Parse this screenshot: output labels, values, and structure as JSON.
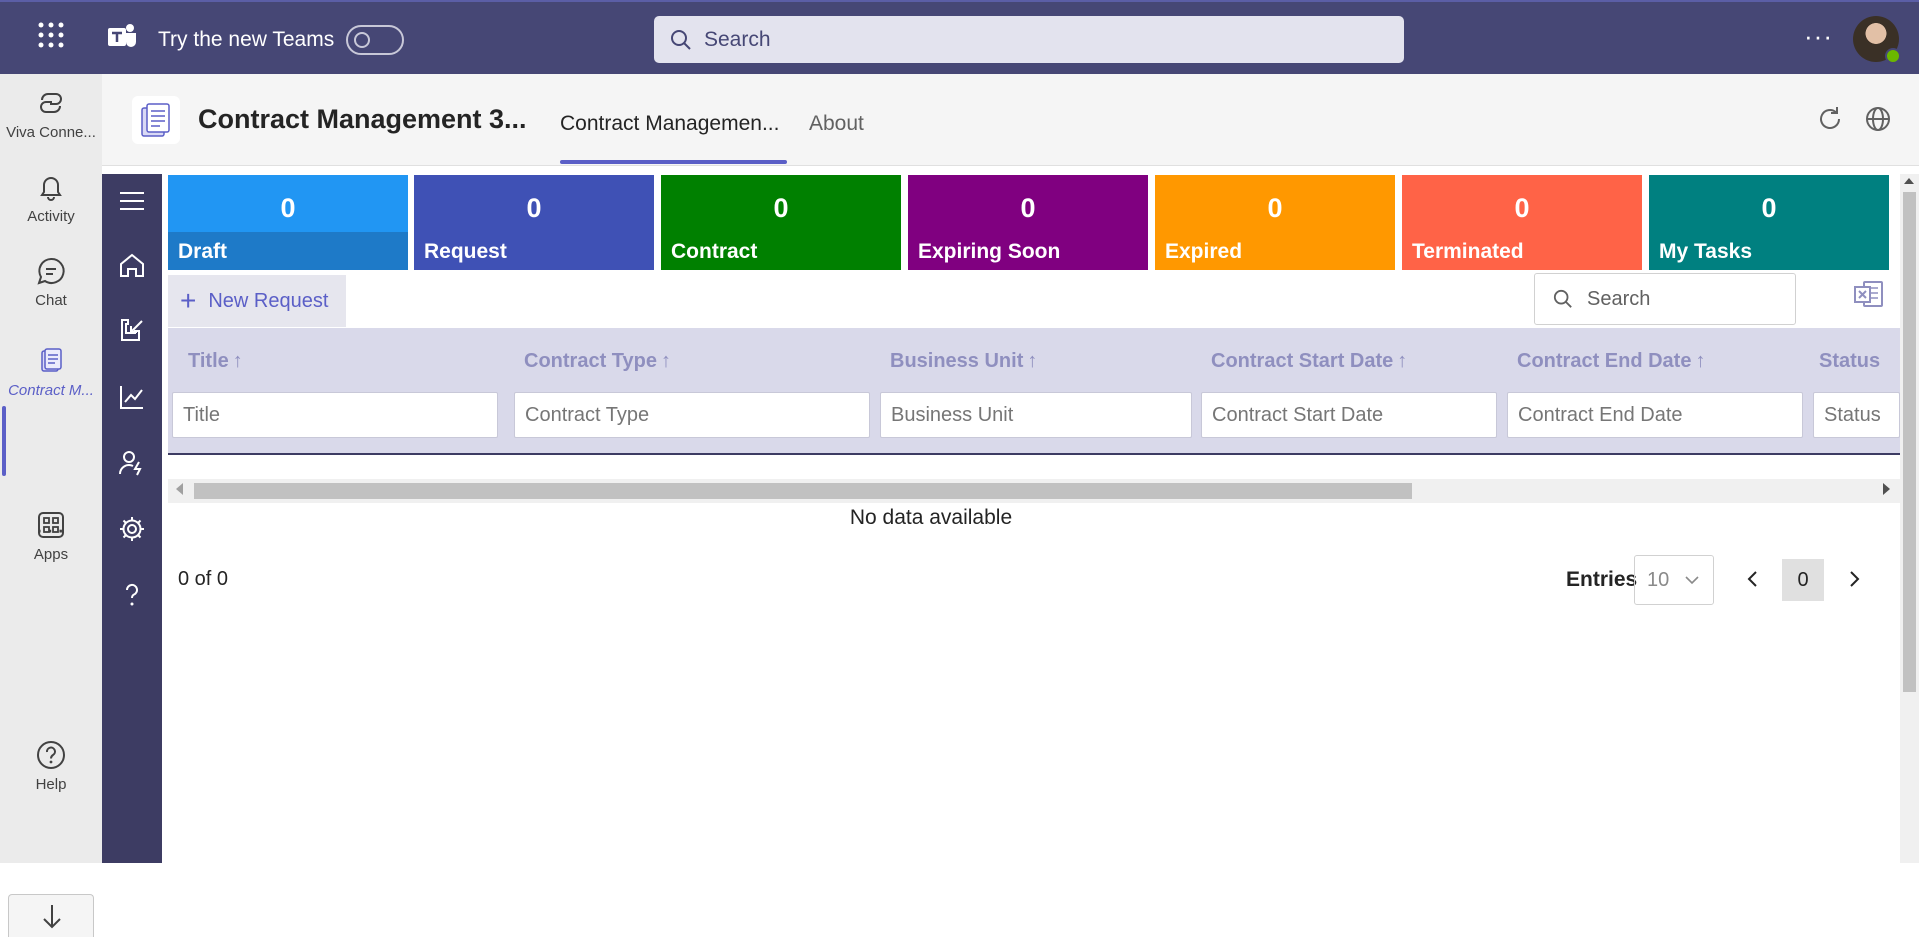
{
  "topbar": {
    "try_label": "Try the new Teams",
    "search_placeholder": "Search",
    "more_label": "···"
  },
  "rail": {
    "items": [
      {
        "label": "Viva Conne...",
        "icon": "viva-connections-icon"
      },
      {
        "label": "Activity",
        "icon": "bell-icon"
      },
      {
        "label": "Chat",
        "icon": "chat-icon"
      },
      {
        "label": "Contract M...",
        "icon": "contract-app-icon"
      },
      {
        "label": "Apps",
        "icon": "apps-icon"
      },
      {
        "label": "Help",
        "icon": "help-icon"
      }
    ],
    "more_label": "···"
  },
  "app": {
    "title": "Contract Management 3...",
    "tabs": [
      {
        "label": "Contract Managemen..."
      },
      {
        "label": "About"
      }
    ]
  },
  "tiles": [
    {
      "label": "Draft",
      "count": "0",
      "color": "#2196f3",
      "strip": "#1e7ac8"
    },
    {
      "label": "Request",
      "count": "0",
      "color": "#3f51b5",
      "strip": "#3f51b5"
    },
    {
      "label": "Contract",
      "count": "0",
      "color": "#008000",
      "strip": "#008000"
    },
    {
      "label": "Expiring Soon",
      "count": "0",
      "color": "#800080",
      "strip": "#800080"
    },
    {
      "label": "Expired",
      "count": "0",
      "color": "#ff9800",
      "strip": "#ff9800"
    },
    {
      "label": "Terminated",
      "count": "0",
      "color": "#ff6347",
      "strip": "#ff6347"
    },
    {
      "label": "My Tasks",
      "count": "0",
      "color": "#008080",
      "strip": "#008080"
    }
  ],
  "toolbar": {
    "new_request_label": "New Request",
    "search_placeholder": "Search"
  },
  "grid": {
    "columns": [
      {
        "header": "Title",
        "filter_placeholder": "Title"
      },
      {
        "header": "Contract Type",
        "filter_placeholder": "Contract Type"
      },
      {
        "header": "Business Unit",
        "filter_placeholder": "Business Unit"
      },
      {
        "header": "Contract Start Date",
        "filter_placeholder": "Contract Start Date"
      },
      {
        "header": "Contract End Date",
        "filter_placeholder": "Contract End Date"
      },
      {
        "header": "Status",
        "filter_placeholder": "Status"
      }
    ],
    "sort_arrow": "↑",
    "empty_text": "No data available"
  },
  "pagination": {
    "count_text": "0 of 0",
    "entries_label": "Entries",
    "entries_value": "10",
    "current_page": "0"
  },
  "colors": {
    "teams_bar": "#464775",
    "accent": "#5b5fc7",
    "app_sidebar": "#3d3c63"
  }
}
